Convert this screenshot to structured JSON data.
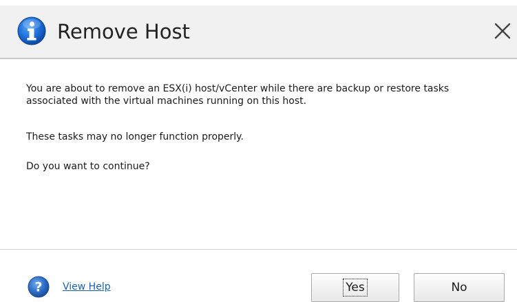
{
  "dialog": {
    "title": "Remove Host",
    "close_icon": "close-icon",
    "title_icon": "info-icon",
    "accent_color": "#1e6fd9"
  },
  "content": {
    "paragraph_1": "You are about to remove an ESX(i) host/vCenter while there are backup or restore tasks associated with the virtual machines running on this host.",
    "paragraph_2": "These tasks may no longer function properly.",
    "paragraph_3": "Do you want to continue?"
  },
  "footer": {
    "help_icon": "help-icon",
    "help_link": "View Help",
    "yes_label": "Yes",
    "no_label": "No"
  }
}
